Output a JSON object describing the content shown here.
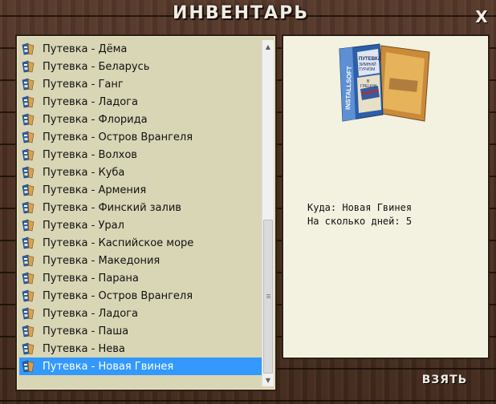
{
  "window": {
    "title": "ИНВЕНТАРЬ",
    "close_label": "X",
    "icon": "close-icon"
  },
  "inventory": {
    "items": [
      {
        "label": "Путевка - Дёма",
        "icon": "travel-voucher-icon"
      },
      {
        "label": "Путевка - Беларусь",
        "icon": "travel-voucher-icon"
      },
      {
        "label": "Путевка - Ганг",
        "icon": "travel-voucher-icon"
      },
      {
        "label": "Путевка - Ладога",
        "icon": "travel-voucher-icon"
      },
      {
        "label": "Путевка - Флорида",
        "icon": "travel-voucher-icon"
      },
      {
        "label": "Путевка - Остров Врангеля",
        "icon": "travel-voucher-icon"
      },
      {
        "label": "Путевка - Волхов",
        "icon": "travel-voucher-icon"
      },
      {
        "label": "Путевка - Куба",
        "icon": "travel-voucher-icon"
      },
      {
        "label": "Путевка - Армения",
        "icon": "travel-voucher-icon"
      },
      {
        "label": "Путевка - Финский залив",
        "icon": "travel-voucher-icon"
      },
      {
        "label": "Путевка - Урал",
        "icon": "travel-voucher-icon"
      },
      {
        "label": "Путевка - Каспийское море",
        "icon": "travel-voucher-icon"
      },
      {
        "label": "Путевка - Македония",
        "icon": "travel-voucher-icon"
      },
      {
        "label": "Путевка - Парана",
        "icon": "travel-voucher-icon"
      },
      {
        "label": "Путевка - Остров Врангеля",
        "icon": "travel-voucher-icon"
      },
      {
        "label": "Путевка - Ладога",
        "icon": "travel-voucher-icon"
      },
      {
        "label": "Путевка - Паша",
        "icon": "travel-voucher-icon"
      },
      {
        "label": "Путевка - Нева",
        "icon": "travel-voucher-icon"
      },
      {
        "label": "Путевка - Новая Гвинея",
        "icon": "travel-voucher-icon"
      }
    ],
    "selected_index": 18
  },
  "detail": {
    "image": {
      "icon": "travel-brochure-image",
      "spine_text": "INSTALLSOFT",
      "cover_lines": [
        "ПУТЕВКА",
        "ЗИМНИЙ",
        "ТУРИЗМ",
        "В",
        "ГРЕЦИИ"
      ]
    },
    "destination_line": "Куда: Новая Гвинея",
    "days_line": "На сколько дней: 5"
  },
  "actions": {
    "take_label": "ВЗЯТЬ"
  },
  "colors": {
    "list_background": "#d8d6b5",
    "detail_background": "#f3f1e0",
    "selection": "#3399ff",
    "wood": "#4a2e1f"
  }
}
